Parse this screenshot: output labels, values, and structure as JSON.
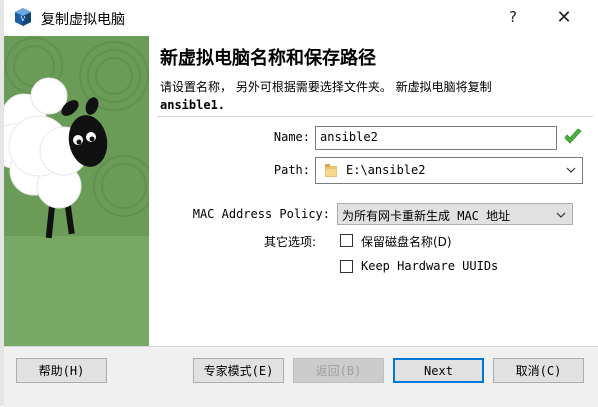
{
  "window": {
    "title": "复制虚拟电脑",
    "help_symbol": "?",
    "close_symbol": "✕"
  },
  "page": {
    "heading": "新虚拟电脑名称和保存路径",
    "description_line1": "请设置名称， 另外可根据需要选择文件夹。 新虚拟电脑将复制",
    "description_line2": "ansible1."
  },
  "form": {
    "name_label": "Name:",
    "name_value": "ansible2",
    "path_label": "Path:",
    "path_value": "E:\\ansible2",
    "mac_label": "MAC Address Policy:",
    "mac_value": "为所有网卡重新生成 MAC 地址",
    "other_label": "其它选项:",
    "option1_label": "保留磁盘名称(D)",
    "option1_checked": false,
    "option2_label": "Keep Hardware UUIDs",
    "option2_checked": false
  },
  "buttons": {
    "help": "帮助(H)",
    "expert": "专家模式(E)",
    "back": "返回(B)",
    "next": "Next",
    "cancel": "取消(C)"
  },
  "icons": {
    "app": "virtualbox-icon",
    "valid": "green-check-icon",
    "folder": "folder-icon",
    "dropdown": "chevron-down-icon"
  },
  "colors": {
    "accent": "#0078d7",
    "valid_green": "#4cb43c",
    "illustration_green": "#6a9b57"
  }
}
